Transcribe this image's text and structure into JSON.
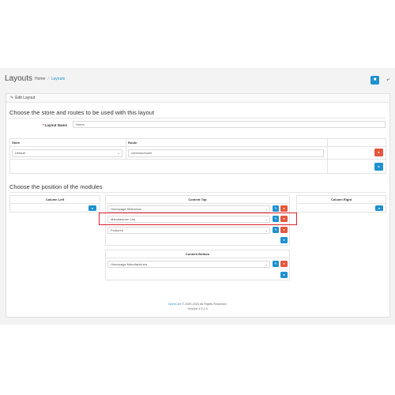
{
  "page": {
    "title": "Layouts",
    "breadcrumb": [
      "Home",
      "Layouts"
    ]
  },
  "panel": {
    "heading": "Edit Layout",
    "legend_routes": "Choose the store and routes to be used with this layout",
    "layout_name_label": "Layout Name",
    "layout_name_value": "Home",
    "routes_table": {
      "headers": [
        "Store",
        "Route"
      ],
      "store_value": "Default",
      "route_value": "common/home"
    },
    "legend_modules": "Choose the position of the modules",
    "columns": {
      "left": "Column Left",
      "top": "Content Top",
      "right": "Column Right",
      "bottom": "Content Bottom"
    },
    "content_top_modules": [
      "Homepage Slideshow",
      "Manufacturer List",
      "Featured"
    ],
    "content_bottom_modules": [
      "Homepage Manufacturers"
    ]
  },
  "footer": {
    "brand": "OpenCart",
    "copyright": "© 2009-2024 All Rights Reserved.",
    "version": "Version 4.0.2.3"
  },
  "colors": {
    "primary": "#1e91cf",
    "danger": "#e4573d",
    "highlight": "#d9232d"
  }
}
